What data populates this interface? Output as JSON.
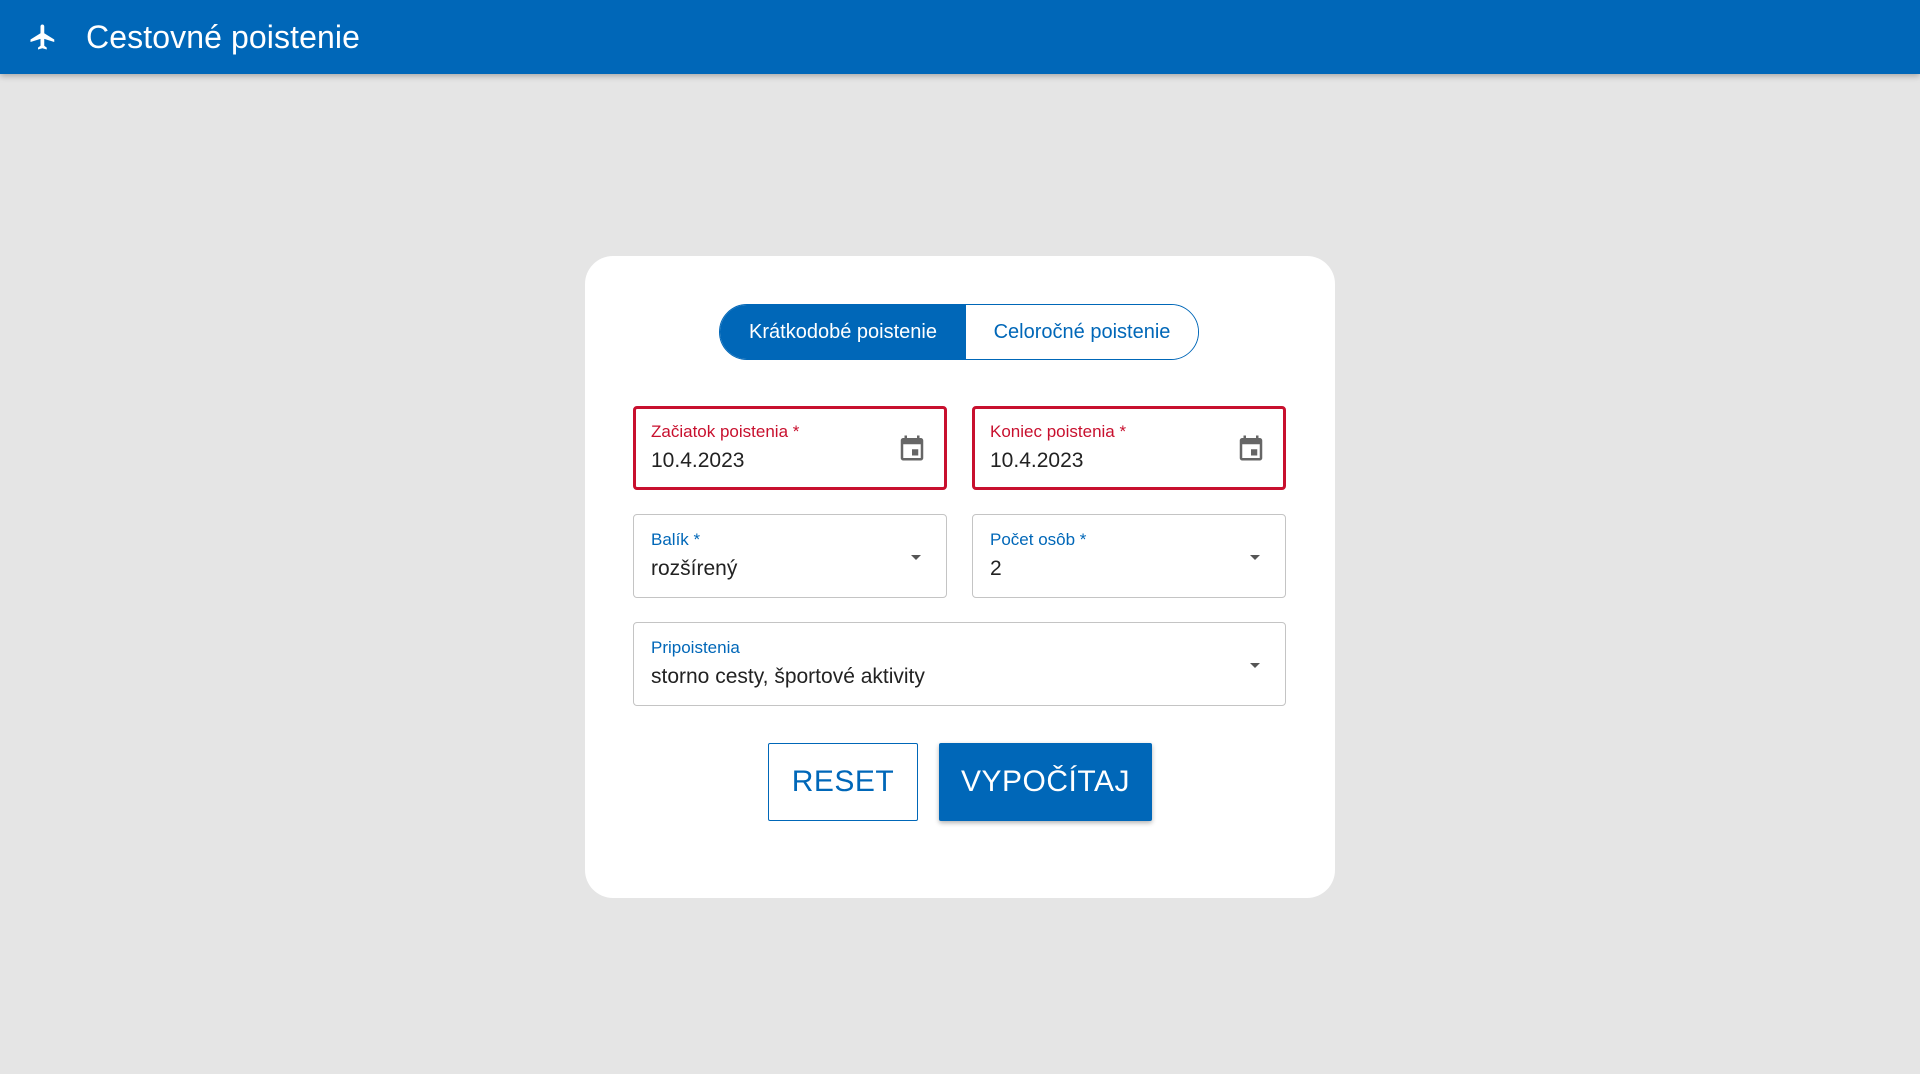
{
  "app": {
    "title": "Cestovné poistenie",
    "icon": "airplane-icon"
  },
  "tabs": [
    {
      "label": "Krátkodobé poistenie",
      "active": true
    },
    {
      "label": "Celoročné poistenie",
      "active": false
    }
  ],
  "form": {
    "start_date": {
      "label": "Začiatok poistenia *",
      "value": "10.4.2023",
      "state": "error",
      "icon": "calendar-icon"
    },
    "end_date": {
      "label": "Koniec poistenia *",
      "value": "10.4.2023",
      "state": "error",
      "icon": "calendar-icon"
    },
    "package": {
      "label": "Balík *",
      "value": "rozšírený",
      "icon": "dropdown-arrow-icon"
    },
    "persons": {
      "label": "Počet osôb *",
      "value": "2",
      "icon": "dropdown-arrow-icon"
    },
    "addons": {
      "label": "Pripoistenia",
      "value": "storno cesty, športové aktivity",
      "icon": "dropdown-arrow-icon"
    }
  },
  "actions": {
    "reset_label": "RESET",
    "calculate_label": "VYPOČÍTAJ"
  },
  "colors": {
    "primary": "#0067b8",
    "error": "#c8102e",
    "background": "#e5e5e5",
    "card": "#ffffff"
  }
}
